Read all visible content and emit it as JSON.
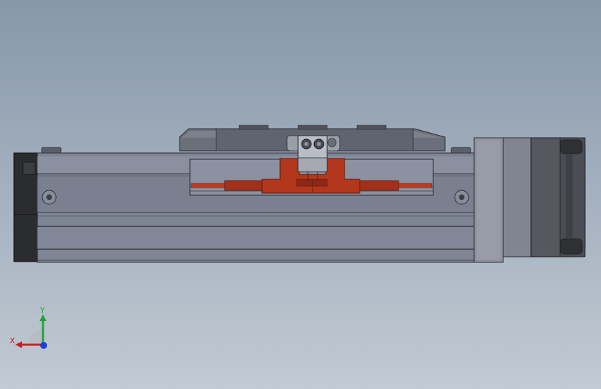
{
  "triad": {
    "x_label": "X",
    "y_label": "Y",
    "x_color": "#cc1f1f",
    "y_color": "#1fa33a",
    "z_color": "#1f3fd6"
  },
  "colors": {
    "background_top": "#8798aa",
    "background_bottom": "#c2cad3",
    "body": "#7f8595",
    "body_dark": "#5a5f6c",
    "carriage": "#b2371c",
    "motor": "#55585f",
    "endcap": "#2b2c2f"
  },
  "icons": [
    "coordinate-triad-icon",
    "screw-head-icon"
  ]
}
